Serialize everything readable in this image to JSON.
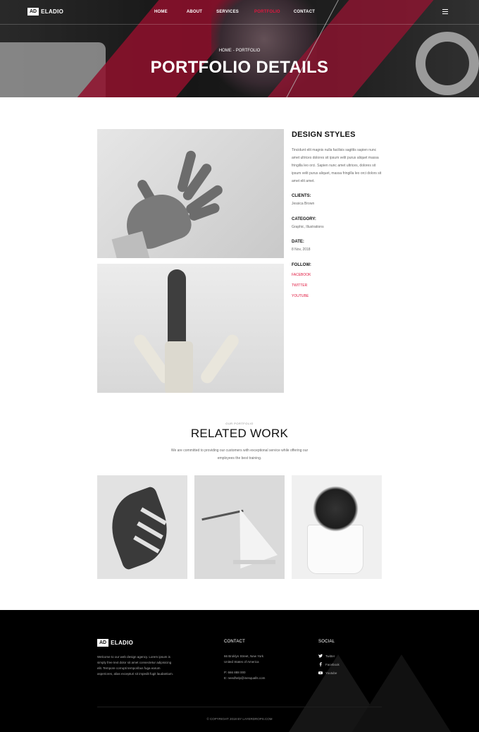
{
  "brand": {
    "badge": "AD",
    "name": "ELADIO"
  },
  "nav": {
    "items": [
      {
        "label": "HOME",
        "active": false
      },
      {
        "label": "ABOUT",
        "active": false
      },
      {
        "label": "SERVICES",
        "active": false
      },
      {
        "label": "PORTFOLIO",
        "active": true
      },
      {
        "label": "CONTACT",
        "active": false
      }
    ],
    "menu_icon": "hamburger-icon"
  },
  "hero": {
    "breadcrumb": {
      "home": "HOME",
      "separator": "-",
      "current": "PORTFOLIO"
    },
    "title": "PORTFOLIO DETAILS"
  },
  "details": {
    "title": "DESIGN STYLES",
    "description": "Tincidunt elit magnis nulla facilisis sagittis sapien nunc amet ultrices dolores sit ipsum velit purus aliquet massa fringilla leo orci. Sapien nunc amet ultrices, dolores sit ipsum velit purus aliquet, massa fringilla leo orci dolors sit amet elit amet.",
    "clients_label": "CLIENTS:",
    "clients_value": "Jessica Brown",
    "category_label": "CATEGORY:",
    "category_value": "Graphic, Illustrations",
    "date_label": "DATE:",
    "date_value": "8 Nov, 2018",
    "follow_label": "FOLLOW:",
    "follow_links": [
      "FACEBOOK",
      "TWITTER",
      "YOUTUBE"
    ]
  },
  "related": {
    "subtitle": "OUR PORTFOLIO",
    "title": "RELATED WORK",
    "description": "We are committed to providing our customers with exceptional service while offering our employees the best training."
  },
  "footer": {
    "about": "Welcome to our web design agency. Lorem ipsum is simply free text dolor sit amet consectetur adipisicing elit. Tempore corrupti temporibus fuga earum asperiores, alias excepturi sit impedit fugit laudantium.",
    "contact_heading": "CONTACT",
    "address_line1": "66 Broklyn Street, New York",
    "address_line2": "United States of America",
    "phone": "P: 666 888 000",
    "email": "E: needhelp@inesqualls.com",
    "social_heading": "SOCIAL",
    "social": [
      {
        "label": "Twitter",
        "icon": "twitter-icon"
      },
      {
        "label": "Facebook",
        "icon": "facebook-icon"
      },
      {
        "label": "Youtube",
        "icon": "youtube-icon"
      }
    ],
    "copyright": "© COPYRIGHT 2018 BY LAYERDROPS.COM"
  },
  "colors": {
    "accent": "#e0183f",
    "footer_bg": "#000000"
  }
}
